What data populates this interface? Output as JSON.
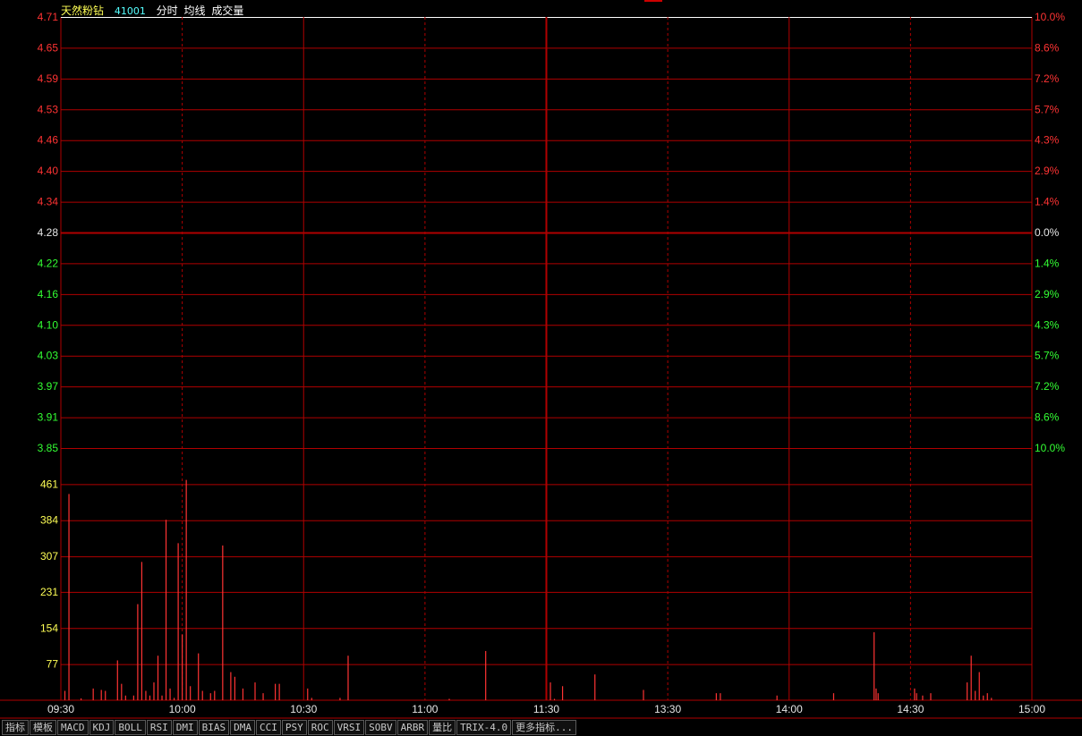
{
  "header": {
    "name": "天然粉钻",
    "code": "41001",
    "items": [
      "分时",
      "均线",
      "成交量"
    ]
  },
  "toolbar": {
    "buttons": [
      "指标",
      "模板",
      "MACD",
      "KDJ",
      "BOLL",
      "RSI",
      "DMI",
      "BIAS",
      "DMA",
      "CCI",
      "PSY",
      "ROC",
      "VRSI",
      "SOBV",
      "ARBR",
      "量比",
      "TRIX-4.0",
      "更多指标..."
    ]
  },
  "colors": {
    "background": "#000000",
    "grid": "#b00000",
    "up": "#ff3333",
    "down": "#33ff33",
    "flat": "#e6e6e6",
    "volume_label": "#ffff55",
    "time_label": "#e6e6e6",
    "volume_bar": "#ff3333"
  },
  "chart_data": [
    {
      "type": "line",
      "title": "",
      "reference_price": 4.28,
      "ylim": [
        3.85,
        4.71
      ],
      "y_ticks_left": [
        "4.71",
        "4.65",
        "4.59",
        "4.53",
        "4.46",
        "4.40",
        "4.34",
        "4.28",
        "4.22",
        "4.16",
        "4.10",
        "4.03",
        "3.97",
        "3.91",
        "3.85"
      ],
      "y_ticks_right": [
        "10.0%",
        "8.6%",
        "7.2%",
        "5.7%",
        "4.3%",
        "2.9%",
        "1.4%",
        "0.0%",
        "1.4%",
        "2.9%",
        "4.3%",
        "5.7%",
        "7.2%",
        "8.6%",
        "10.0%"
      ],
      "x_ticks": [
        "09:30",
        "10:00",
        "10:30",
        "11:00",
        "11:30",
        "13:30",
        "14:00",
        "14:30",
        "15:00"
      ],
      "series": [],
      "grid": true
    },
    {
      "type": "bar",
      "title": "",
      "ylim": [
        0,
        538
      ],
      "y_ticks": [
        "461",
        "384",
        "307",
        "231",
        "154",
        "77"
      ],
      "x_ticks": [
        "09:30",
        "10:00",
        "10:30",
        "11:00",
        "11:30",
        "13:30",
        "14:00",
        "14:30",
        "15:00"
      ],
      "x_unit": "minutes from 09:30 (trading minutes, 0-240)",
      "series": [
        {
          "x": [
            1,
            2,
            5,
            8,
            10,
            11,
            14,
            15,
            16,
            18,
            19,
            20,
            21,
            22,
            23,
            24,
            25,
            26,
            27,
            28,
            29,
            30,
            31,
            32,
            34,
            35,
            37,
            38,
            40,
            42,
            43,
            45,
            48,
            50,
            53,
            54,
            61,
            62,
            69,
            71,
            96,
            105,
            121,
            122,
            124,
            132,
            144,
            162,
            163,
            177,
            191,
            201,
            201.5,
            202,
            211,
            211.5,
            213,
            215,
            224,
            225,
            226,
            227,
            228,
            229,
            230
          ],
          "values": [
            20,
            440,
            4,
            25,
            22,
            20,
            85,
            35,
            10,
            10,
            205,
            295,
            20,
            10,
            38,
            95,
            10,
            385,
            25,
            5,
            335,
            140,
            470,
            30,
            100,
            20,
            15,
            20,
            330,
            60,
            50,
            25,
            38,
            15,
            35,
            35,
            25,
            5,
            5,
            95,
            3,
            105,
            38,
            3,
            30,
            55,
            22,
            15,
            15,
            10,
            15,
            145,
            25,
            15,
            25,
            15,
            10,
            15,
            38,
            95,
            20,
            60,
            10,
            15,
            5
          ]
        }
      ]
    }
  ]
}
